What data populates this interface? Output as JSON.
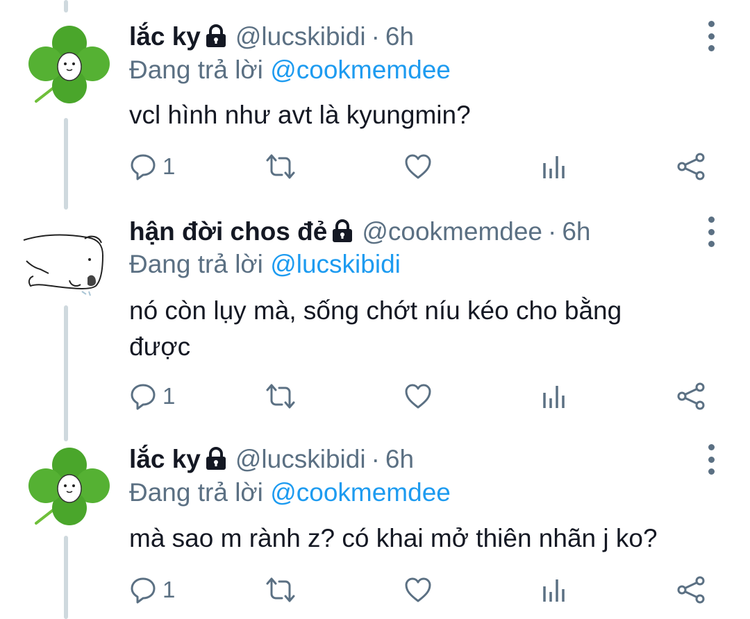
{
  "colors": {
    "text": "#141823",
    "secondary": "#5b7083",
    "accent": "#1d9bf0",
    "thread_line": "#cfd9de",
    "clover": "#4aa62b"
  },
  "tweets": [
    {
      "name": "lắc ky",
      "handle": "@lucskibidi",
      "separator": "·",
      "time": "6h",
      "reply_prefix": "Đang trả lời",
      "reply_to": "@cookmemdee",
      "text": "vcl hình như avt là kyungmin?",
      "reply_count": "1",
      "avatar": "clover-avatar",
      "icons": [
        "lock-icon",
        "more-icon",
        "reply-icon",
        "retweet-icon",
        "like-icon",
        "analytics-icon",
        "share-icon"
      ]
    },
    {
      "name": "hận đời chos đẻ",
      "handle": "@cookmemdee",
      "separator": "·",
      "time": "6h",
      "reply_prefix": "Đang trả lời",
      "reply_to": "@lucskibidi",
      "text": "nó còn lụy mà, sống chớt níu kéo cho bằng được",
      "reply_count": "1",
      "avatar": "sketch-animal-avatar",
      "icons": [
        "lock-icon",
        "more-icon",
        "reply-icon",
        "retweet-icon",
        "like-icon",
        "analytics-icon",
        "share-icon"
      ]
    },
    {
      "name": "lắc ky",
      "handle": "@lucskibidi",
      "separator": "·",
      "time": "6h",
      "reply_prefix": "Đang trả lời",
      "reply_to": "@cookmemdee",
      "text": "mà sao m rành z? có khai mở thiên nhãn j ko?",
      "reply_count": "1",
      "avatar": "clover-avatar",
      "icons": [
        "lock-icon",
        "more-icon",
        "reply-icon",
        "retweet-icon",
        "like-icon",
        "analytics-icon",
        "share-icon"
      ]
    }
  ]
}
